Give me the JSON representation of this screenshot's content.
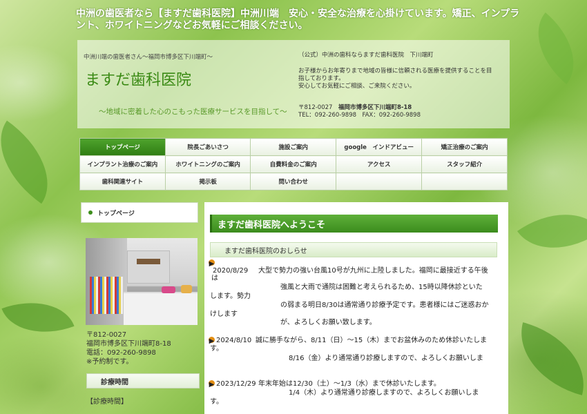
{
  "headline": "中洲の歯医者なら【ますだ歯科医院】中洲川端　安心・安全な治療を心掛けています。矯正、インプラント、ホワイトニングなどお気軽にご相談ください。",
  "header": {
    "breadcrumb": "中洲川端の歯医者さん～福岡市博多区下川端町～",
    "title": "ますだ歯科医院",
    "tagline": "～地域に密着した心のこもった医療サービスを目指して～",
    "official": "（公式）中洲の歯科ならますだ歯科医院　下川端町",
    "desc1": "お子様からお年寄りまで地域の皆様に信頼される医療を提供することを目",
    "desc2": "指しております。",
    "desc3": "安心してお気軽にご相談、ご来院ください。",
    "zip": "〒812-0027",
    "address": "福岡市博多区下川端町8-18",
    "tel_line": "TEL：092-260-9898　FAX：092-260-9898"
  },
  "nav": {
    "row1": [
      "トップページ",
      "院長ごあいさつ",
      "施設ご案内",
      "google　インドアビュー",
      "矯正治療のご案内"
    ],
    "row2": [
      "インプラント治療のご案内",
      "ホワイトニングのご案内",
      "自費料金のご案内",
      "アクセス",
      "スタッフ紹介"
    ],
    "row3": [
      "歯科関連サイト",
      "掲示板",
      "問い合わせ",
      "",
      ""
    ]
  },
  "sidebar": {
    "top_label": "トップページ",
    "zip": "〒812-0027",
    "address": "福岡市博多区下川端町8-18",
    "tel": "電話：092-260-9898",
    "note": "※予約制です。",
    "hours_heading": "診療時間",
    "hours_label": "【診療時間】"
  },
  "main": {
    "welcome": "ますだ歯科医院へようこそ",
    "news_heading": "ますだ歯科医院のおしらせ",
    "news": [
      {
        "date": "2020/8/29",
        "l1": "大型で勢力の強い台風10号が九州に上陸しました。福岡に最接近する午後",
        "l2a": "は",
        "l2b": "強風と大雨で通院は困難と考えられるため、15時以降休診といた",
        "l3a": "します。勢力",
        "l3b": "の弱まる明日8/30は通常通り診療予定です。患者様にはご迷惑おか",
        "l4a": "けします",
        "l4b": "が、よろしくお願い致します。"
      },
      {
        "date": "2024/8/10",
        "l1": "誠に勝手ながら、8/11（日）～15（木）までお盆休みのため休診いたしま",
        "l2a": "す。",
        "l2b": "8/16（金）より通常通り診療しますので、よろしくお願いしま"
      },
      {
        "date": "2023/12/29",
        "l1": "年末年始は12/30（土）～1/3（水）まで休診いたします。",
        "l2a": "す。",
        "l2b": "1/4（木）より通常通り診療しますので、よろしくお願いしま"
      }
    ]
  },
  "colors": {
    "accent": "#3b8c1d",
    "nav_active": "#2f7d13",
    "news_arrow": "#e38e12"
  }
}
